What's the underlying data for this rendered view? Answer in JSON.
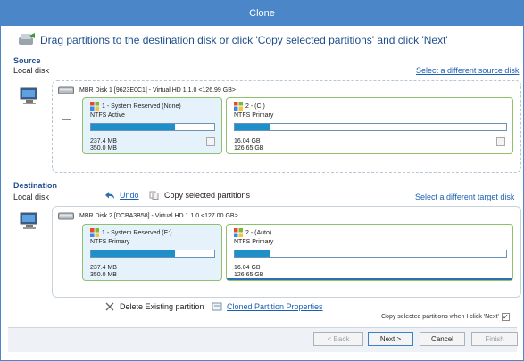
{
  "window": {
    "title": "Clone"
  },
  "instruction": "Drag partitions to the destination disk or click 'Copy selected partitions' and click 'Next'",
  "source": {
    "title": "Source",
    "subtitle": "Local disk",
    "select_link": "Select a different source disk",
    "disk_label": "MBR Disk 1 [9623E0C1] - Virtual HD 1.1.0  <126.99 GB>",
    "partitions": [
      {
        "title": "1 - System Reserved (None)",
        "type": "NTFS Active",
        "used": "237.4 MB",
        "total": "350.0 MB",
        "fill": 0.68
      },
      {
        "title": "2 -  (C:)",
        "type": "NTFS Primary",
        "used": "16.04 GB",
        "total": "126.65 GB",
        "fill": 0.13
      }
    ]
  },
  "destination": {
    "title": "Destination",
    "subtitle": "Local disk",
    "undo": "Undo",
    "copy_selected": "Copy selected partitions",
    "select_link": "Select a different target disk",
    "disk_label": "MBR Disk 2 [DCBA3B58] - Virtual HD 1.1.0  <127.00 GB>",
    "partitions": [
      {
        "title": "1 - System Reserved (E:)",
        "type": "NTFS Primary",
        "used": "237.4 MB",
        "total": "350.0 MB",
        "fill": 0.68
      },
      {
        "title": "2 -  (Auto)",
        "type": "NTFS Primary",
        "used": "16.04 GB",
        "total": "126.65 GB",
        "fill": 0.13
      }
    ]
  },
  "actions": {
    "delete_existing": "Delete Existing partition",
    "cloned_props": "Cloned Partition Properties",
    "copy_on_next": "Copy selected partitions when I click 'Next'"
  },
  "buttons": {
    "back": "< Back",
    "next": "Next >",
    "cancel": "Cancel",
    "finish": "Finish"
  },
  "colors": {
    "accent": "#4a86c8",
    "bar_fill": "#1e8fc8",
    "partition_border": "#8dc26a"
  },
  "icons": {
    "clone": "clone-icon",
    "computer": "computer-icon",
    "disk": "hard-disk-icon",
    "windows": "windows-logo-icon"
  }
}
